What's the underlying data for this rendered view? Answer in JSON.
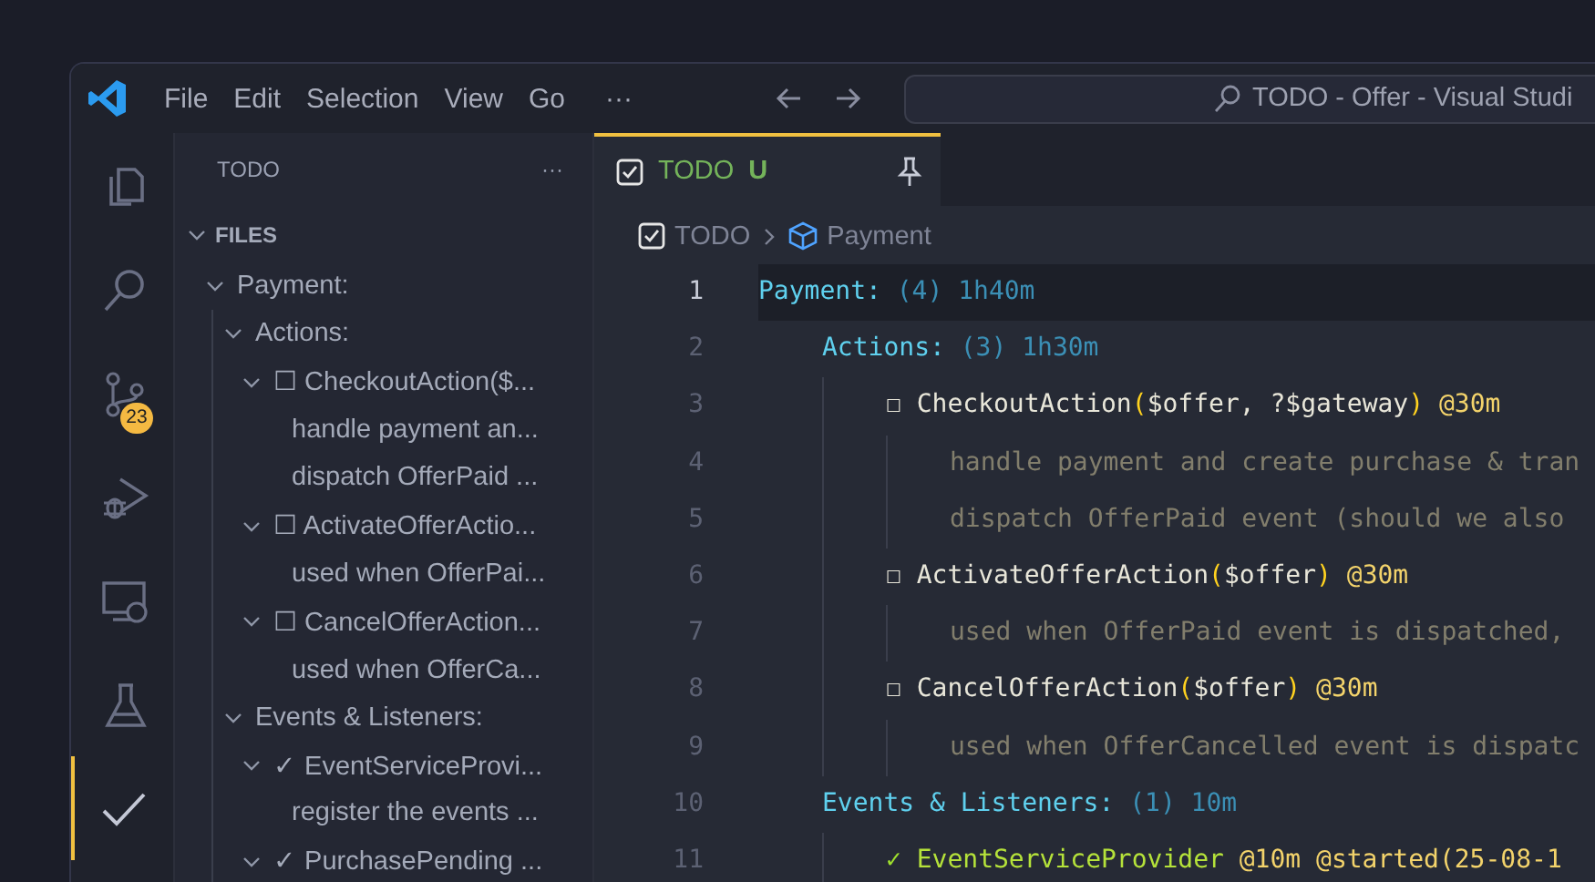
{
  "title_bar": {
    "menu": [
      "File",
      "Edit",
      "Selection",
      "View",
      "Go"
    ],
    "more": "···",
    "search": "TODO - Offer - Visual Studi"
  },
  "activity_bar": [
    {
      "kind": "files",
      "selected": false
    },
    {
      "kind": "search",
      "selected": false
    },
    {
      "kind": "source-control",
      "selected": false,
      "badge": "23"
    },
    {
      "kind": "run-debug",
      "selected": false
    },
    {
      "kind": "remote",
      "selected": false
    },
    {
      "kind": "testing",
      "selected": false
    },
    {
      "kind": "todo",
      "selected": true
    }
  ],
  "sidebar": {
    "title": "TODO",
    "more": "···",
    "section": {
      "label": "FILES",
      "expanded": true
    },
    "tree": [
      {
        "label": "Payment:",
        "expanded": true,
        "children": [
          {
            "label": "Actions:",
            "expanded": true,
            "children": [
              {
                "label": "☐ CheckoutAction($...",
                "expanded": true,
                "children": [
                  {
                    "label": "handle payment an..."
                  },
                  {
                    "label": "dispatch OfferPaid ..."
                  }
                ]
              },
              {
                "label": "☐ ActivateOfferActio...",
                "expanded": true,
                "children": [
                  {
                    "label": "used when OfferPai..."
                  }
                ]
              },
              {
                "label": "☐ CancelOfferAction...",
                "expanded": true,
                "children": [
                  {
                    "label": "used when OfferCa..."
                  }
                ]
              }
            ]
          },
          {
            "label": "Events & Listeners:",
            "expanded": true,
            "children": [
              {
                "label": "✓ EventServiceProvi...",
                "expanded": true,
                "children": [
                  {
                    "label": "register the events ..."
                  }
                ]
              },
              {
                "label": "✓ PurchasePending ...",
                "expanded": true
              }
            ]
          }
        ]
      }
    ]
  },
  "editor": {
    "tabs": [
      {
        "label": "TODO",
        "status": "U",
        "selected": true,
        "pinned": true
      }
    ],
    "breadcrumb": [
      "TODO",
      "Payment"
    ],
    "lines": [
      {
        "number": "1",
        "current": true,
        "tokens": [
          {
            "kind": "heading",
            "text": "Payment:"
          },
          {
            "kind": "meta",
            "text": " (4) 1h40m"
          }
        ],
        "children": [
          {
            "number": "2",
            "current": false,
            "tokens": [
              {
                "kind": "heading",
                "text": "Actions:"
              },
              {
                "kind": "meta",
                "text": " (3) 1h30m"
              }
            ],
            "children": [
              {
                "number": "3",
                "current": false,
                "tokens": [
                  {
                    "kind": "box",
                    "text": "☐ "
                  },
                  {
                    "kind": "task",
                    "text": "CheckoutAction"
                  },
                  {
                    "kind": "paren",
                    "text": "("
                  },
                  {
                    "kind": "task",
                    "text": "$offer, ?$gateway"
                  },
                  {
                    "kind": "paren",
                    "text": ")"
                  },
                  {
                    "kind": "tag",
                    "text": " @30m"
                  }
                ],
                "children": [
                  {
                    "number": "4",
                    "current": false,
                    "tokens": [
                      {
                        "kind": "note",
                        "text": "handle payment and create purchase & tran"
                      }
                    ]
                  },
                  {
                    "number": "5",
                    "current": false,
                    "tokens": [
                      {
                        "kind": "note",
                        "text": "dispatch OfferPaid event (should we also"
                      }
                    ]
                  }
                ]
              },
              {
                "number": "6",
                "current": false,
                "tokens": [
                  {
                    "kind": "box",
                    "text": "☐ "
                  },
                  {
                    "kind": "task",
                    "text": "ActivateOfferAction"
                  },
                  {
                    "kind": "paren",
                    "text": "("
                  },
                  {
                    "kind": "task",
                    "text": "$offer"
                  },
                  {
                    "kind": "paren",
                    "text": ")"
                  },
                  {
                    "kind": "tag",
                    "text": " @30m"
                  }
                ],
                "children": [
                  {
                    "number": "7",
                    "current": false,
                    "tokens": [
                      {
                        "kind": "note",
                        "text": "used when OfferPaid event is dispatched,"
                      }
                    ]
                  }
                ]
              },
              {
                "number": "8",
                "current": false,
                "tokens": [
                  {
                    "kind": "box",
                    "text": "☐ "
                  },
                  {
                    "kind": "task",
                    "text": "CancelOfferAction"
                  },
                  {
                    "kind": "paren",
                    "text": "("
                  },
                  {
                    "kind": "task",
                    "text": "$offer"
                  },
                  {
                    "kind": "paren",
                    "text": ")"
                  },
                  {
                    "kind": "tag",
                    "text": " @30m"
                  }
                ],
                "children": [
                  {
                    "number": "9",
                    "current": false,
                    "tokens": [
                      {
                        "kind": "note",
                        "text": "used when OfferCancelled event is dispatc"
                      }
                    ]
                  }
                ]
              }
            ]
          },
          {
            "number": "10",
            "current": false,
            "tokens": [
              {
                "kind": "heading",
                "text": "Events & Listeners:"
              },
              {
                "kind": "meta",
                "text": " (1) 10m"
              }
            ],
            "children": [
              {
                "number": "11",
                "current": false,
                "tokens": [
                  {
                    "kind": "done",
                    "text": "✓ "
                  },
                  {
                    "kind": "done-task",
                    "text": "EventServiceProvider"
                  },
                  {
                    "kind": "tag",
                    "text": " @10m @started(25-08-1"
                  }
                ]
              }
            ]
          }
        ]
      }
    ]
  }
}
